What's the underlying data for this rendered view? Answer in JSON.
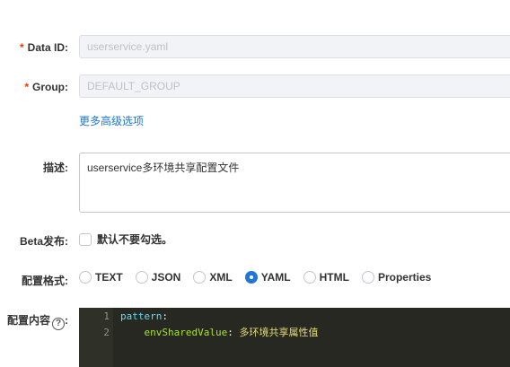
{
  "fields": {
    "data_id": {
      "required_mark": "*",
      "label": "Data ID:",
      "value": "userservice.yaml"
    },
    "group": {
      "required_mark": "*",
      "label": "Group:",
      "value": "DEFAULT_GROUP"
    },
    "more_options_link": "更多高级选项",
    "description": {
      "label": "描述:",
      "value": "userservice多环境共享配置文件"
    },
    "beta": {
      "label": "Beta发布:",
      "checkbox_label": "默认不要勾选。",
      "checked": false
    },
    "format": {
      "label": "配置格式:",
      "options": [
        "TEXT",
        "JSON",
        "XML",
        "YAML",
        "HTML",
        "Properties"
      ],
      "selected": "YAML"
    },
    "content": {
      "label": "配置内容",
      "help_icon_glyph": "?",
      "lines": [
        {
          "no": "1",
          "indent": "",
          "key": "pattern",
          "colon": ":",
          "value": ""
        },
        {
          "no": "2",
          "indent": "    ",
          "key": "envSharedValue",
          "colon": ":",
          "value": " 多环境共享属性值"
        }
      ]
    }
  },
  "colors": {
    "required": "#ff3000",
    "link": "#2077d2",
    "radio_selected": "#2077d2",
    "editor_bg": "#272822"
  }
}
